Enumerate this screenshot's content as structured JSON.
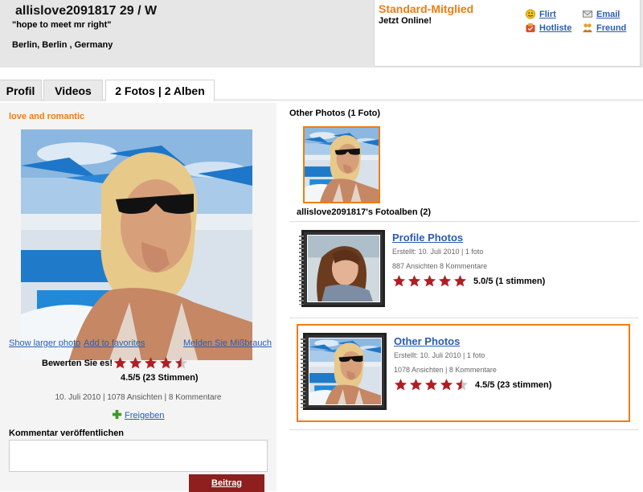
{
  "profile": {
    "username_line": "allislove2091817 29 / W",
    "tagline": "\"hope to meet mr right\"",
    "location": "Berlin, Berlin , Germany"
  },
  "member_box": {
    "status": "Standard-Mitglied",
    "online": "Jetzt Online!",
    "links": {
      "flirt": "Flirt",
      "hotlist": "Hotliste",
      "email": "Email",
      "friend": "Freund"
    }
  },
  "tabs": [
    {
      "label": "Profil",
      "active": false
    },
    {
      "label": "Videos",
      "active": false
    },
    {
      "label": "2 Fotos | 2 Alben",
      "active": true
    }
  ],
  "photo_panel": {
    "caption": "love and romantic",
    "actions": {
      "show_larger": "Show larger photo",
      "add_favorites": "Add to favorites",
      "report": "Melden Sie Mißbrauch"
    },
    "rate_label": "Bewerten Sie es!",
    "rating_value": 4.5,
    "rating_text": "4.5/5 (23 Stimmen)",
    "meta": "10. Juli 2010 | 1078 Ansichten | 8 Kommentare",
    "share_label": "Freigeben"
  },
  "comment": {
    "title": "Kommentar veröffentlichen",
    "placeholder": "",
    "submit_label": "Beitrag"
  },
  "right_panel": {
    "other_photos_title": "Other Photos (1 Foto)",
    "albums_title": "allislove2091817's Fotoalben (2)",
    "albums": [
      {
        "title": "Profile Photos",
        "created": "Erstellt: 10. Juli 2010 | 1 foto",
        "stats": "887 Ansichten 8 Kommentare",
        "rating_value": 5.0,
        "rating_text": "5.0/5 (1 stimmen)"
      },
      {
        "title": "Other Photos",
        "created": "Erstellt: 10. Juli 2010 | 1 foto",
        "stats": "1078 Ansichten | 8 Kommentare",
        "rating_value": 4.5,
        "rating_text": "4.5/5 (23 stimmen)"
      }
    ]
  },
  "colors": {
    "accent_orange": "#ef7d10",
    "link_blue": "#2a5db0",
    "star_red": "#b01e24",
    "button_dark_red": "#8e1f1f"
  }
}
